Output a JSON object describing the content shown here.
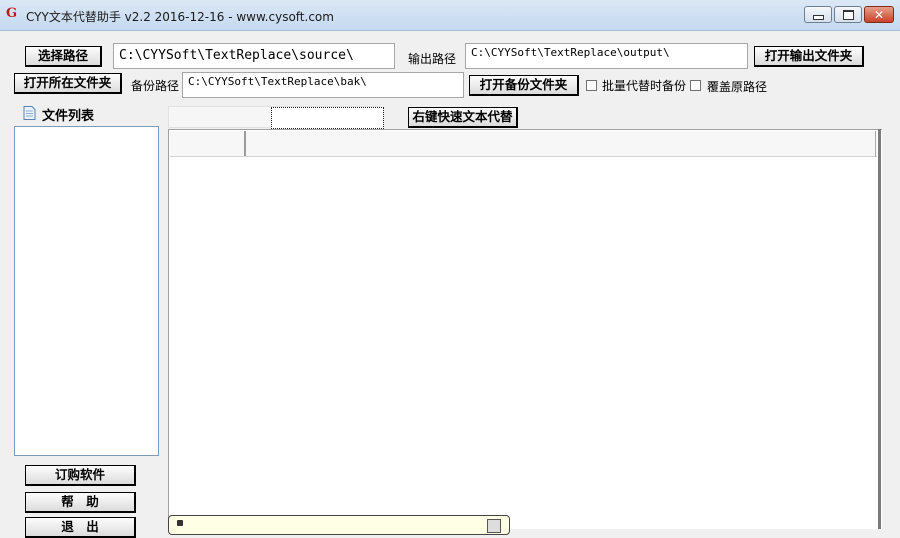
{
  "window": {
    "title": "CYY文本代替助手 v2.2 2016-12-16 - www.cysoft.com",
    "app_icon": "G",
    "close_glyph": "✕"
  },
  "paths": {
    "select_path_button": "选择路径",
    "source_path": "C:\\CYYSoft\\TextReplace\\source\\",
    "output_label": "输出路径",
    "output_path": "C:\\CYYSoft\\TextReplace\\output\\",
    "open_output_button": "打开输出文件夹",
    "open_folder_button": "打开所在文件夹",
    "backup_label": "备份路径",
    "backup_path": "C:\\CYYSoft\\TextReplace\\bak\\",
    "open_backup_button": "打开备份文件夹",
    "batch_backup_label": "批量代替时备份",
    "batch_backup_checked": false,
    "overwrite_label": "覆盖原路径",
    "overwrite_checked": false
  },
  "sidebar": {
    "file_list_title": "文件列表",
    "order_button": "订购软件",
    "help_button": "帮　助",
    "exit_button": "退　出"
  },
  "toolbar": {
    "quick_replace_button": "右键快速文本代替"
  },
  "colors": {
    "window_bg": "#f0f0f0",
    "titlebar": "#c5d9ef",
    "close_button": "#c9422a",
    "list_border": "#7f9db9"
  }
}
